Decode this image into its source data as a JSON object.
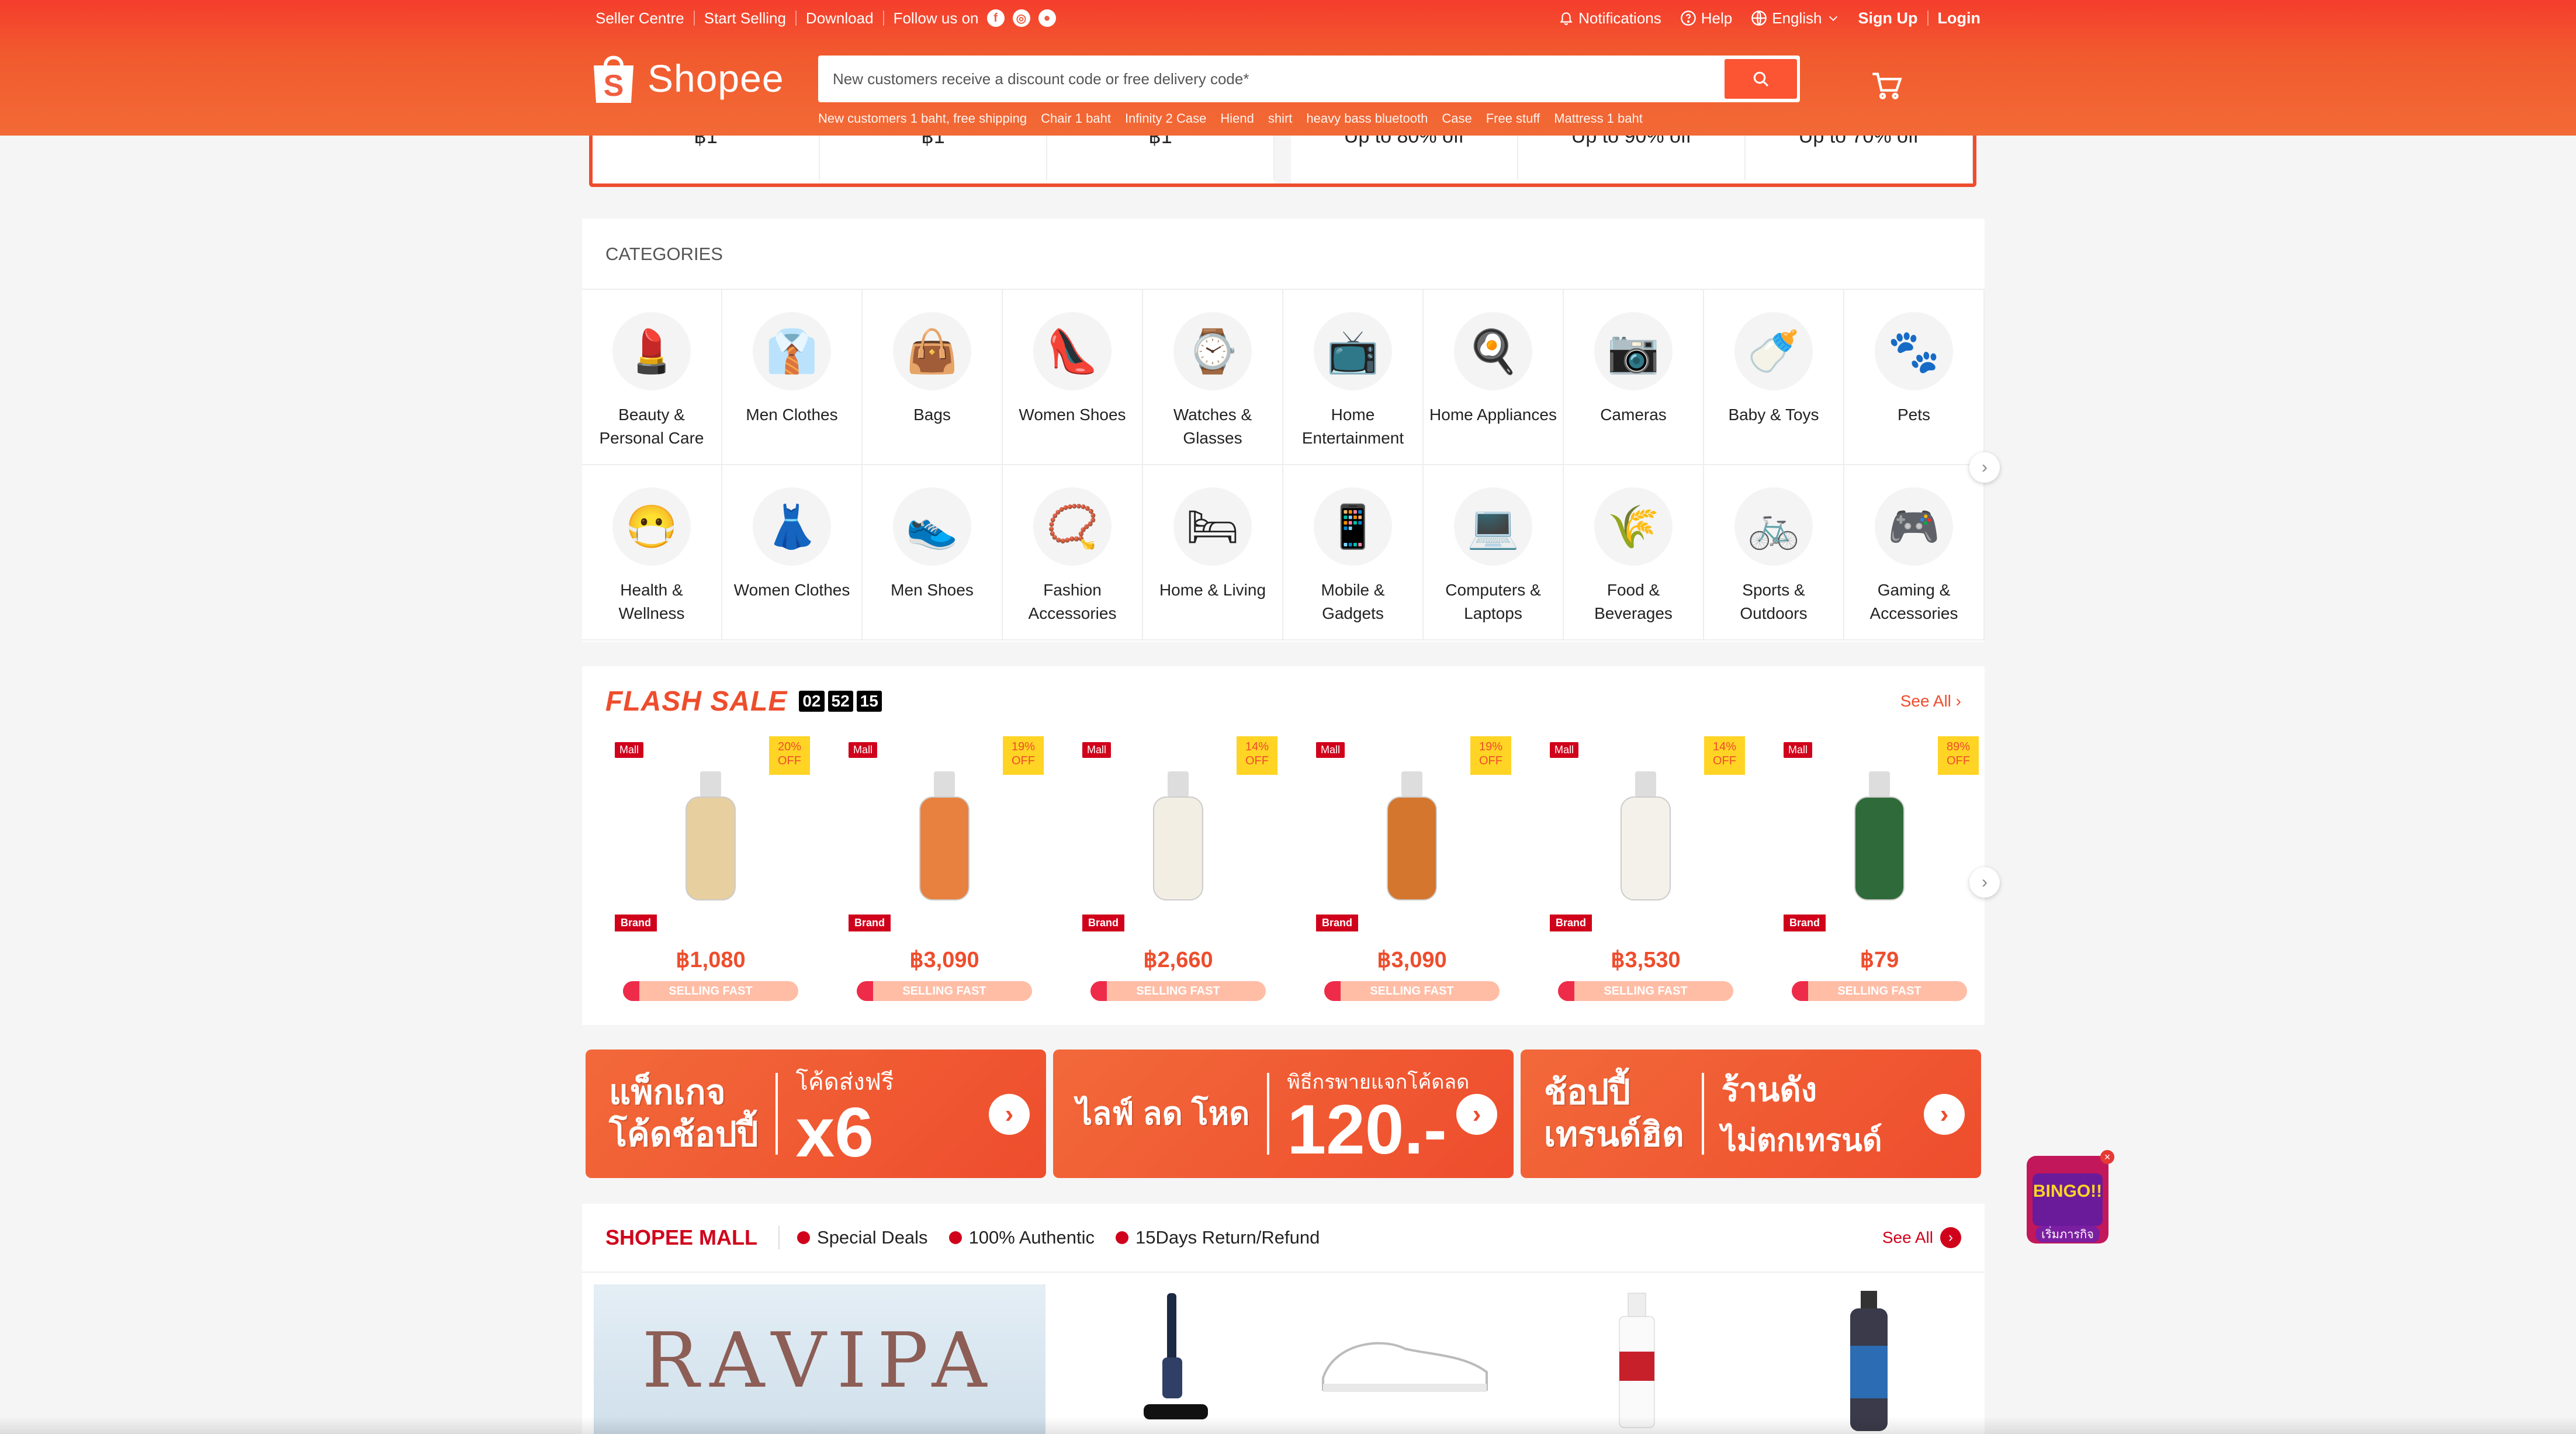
{
  "topbar": {
    "seller_centre": "Seller Centre",
    "start_selling": "Start Selling",
    "download": "Download",
    "follow_us": "Follow us on",
    "notifications": "Notifications",
    "help": "Help",
    "language": "English",
    "sign_up": "Sign Up",
    "login": "Login"
  },
  "logo": {
    "text": "Shopee",
    "bag_letter": "S"
  },
  "search": {
    "placeholder": "New customers receive a discount code or free delivery code*",
    "hotwords": [
      "New customers 1 baht, free shipping",
      "Chair 1 baht",
      "Infinity 2 Case",
      "Hiend",
      "shirt",
      "heavy bass bluetooth",
      "Case",
      "Free stuff",
      "Mattress 1 baht"
    ]
  },
  "promo_strip": [
    "฿1",
    "฿1",
    "฿1",
    "Up to 80% off",
    "Up to 90% off",
    "Up to 70% off"
  ],
  "categories": {
    "title": "CATEGORIES",
    "items": [
      {
        "label": "Beauty & Personal Care",
        "icon": "💄"
      },
      {
        "label": "Men Clothes",
        "icon": "👔"
      },
      {
        "label": "Bags",
        "icon": "👜"
      },
      {
        "label": "Women Shoes",
        "icon": "👠"
      },
      {
        "label": "Watches & Glasses",
        "icon": "⌚"
      },
      {
        "label": "Home Entertainment",
        "icon": "📺"
      },
      {
        "label": "Home Appliances",
        "icon": "🍳"
      },
      {
        "label": "Cameras",
        "icon": "📷"
      },
      {
        "label": "Baby & Toys",
        "icon": "🍼"
      },
      {
        "label": "Pets",
        "icon": "🐾"
      },
      {
        "label": "Health & Wellness",
        "icon": "😷"
      },
      {
        "label": "Women Clothes",
        "icon": "👗"
      },
      {
        "label": "Men Shoes",
        "icon": "👟"
      },
      {
        "label": "Fashion Accessories",
        "icon": "📿"
      },
      {
        "label": "Home & Living",
        "icon": "🛏"
      },
      {
        "label": "Mobile & Gadgets",
        "icon": "📱"
      },
      {
        "label": "Computers & Laptops",
        "icon": "💻"
      },
      {
        "label": "Food & Beverages",
        "icon": "🌾"
      },
      {
        "label": "Sports & Outdoors",
        "icon": "🚲"
      },
      {
        "label": "Gaming & Accessories",
        "icon": "🎮"
      }
    ]
  },
  "flash_sale": {
    "title": "FLASH SALE",
    "timer": [
      "02",
      "52",
      "15"
    ],
    "see_all": "See All",
    "mall_label": "Mall",
    "brand_label": "Brand",
    "off_label": "OFF",
    "selling_label": "SELLING FAST",
    "items": [
      {
        "discount": "20%",
        "price": "฿1,080",
        "color": "#e7cfa0"
      },
      {
        "discount": "19%",
        "price": "฿3,090",
        "color": "#e8813f"
      },
      {
        "discount": "14%",
        "price": "฿2,660",
        "color": "#f3eee4"
      },
      {
        "discount": "19%",
        "price": "฿3,090",
        "color": "#d4762e"
      },
      {
        "discount": "14%",
        "price": "฿3,530",
        "color": "#f4f1ea"
      },
      {
        "discount": "89%",
        "price": "฿79",
        "color": "#2f6b3a"
      }
    ]
  },
  "banners": [
    {
      "left": "แพ็กเกจ\nโค้ดช้อปปี้",
      "right_top": "โค้ดส่งฟรี",
      "right_big": "x6"
    },
    {
      "left": "ไลฟ์ ลด โหด",
      "right_top": "พิธีกรพายแจกโค้ดลด",
      "right_big": "120.-"
    },
    {
      "left": "ช้อปปี้\nเทรนด์ฮิต",
      "right_top": "ร้านดัง",
      "right_big": "ไม่ตกเทรนด์"
    }
  ],
  "mall": {
    "title": "SHOPEE MALL",
    "features": [
      "Special Deals",
      "100% Authentic",
      "15Days Return/Refund"
    ],
    "see_all": "See All",
    "brand_banner": "RAVIPA"
  },
  "bingo": {
    "label": "BINGO!!",
    "sub": "เริ่มภารกิจ"
  },
  "colors": {
    "brand": "#ee4d2d",
    "mall": "#d0011b",
    "flash_badge": "#ffd424"
  }
}
